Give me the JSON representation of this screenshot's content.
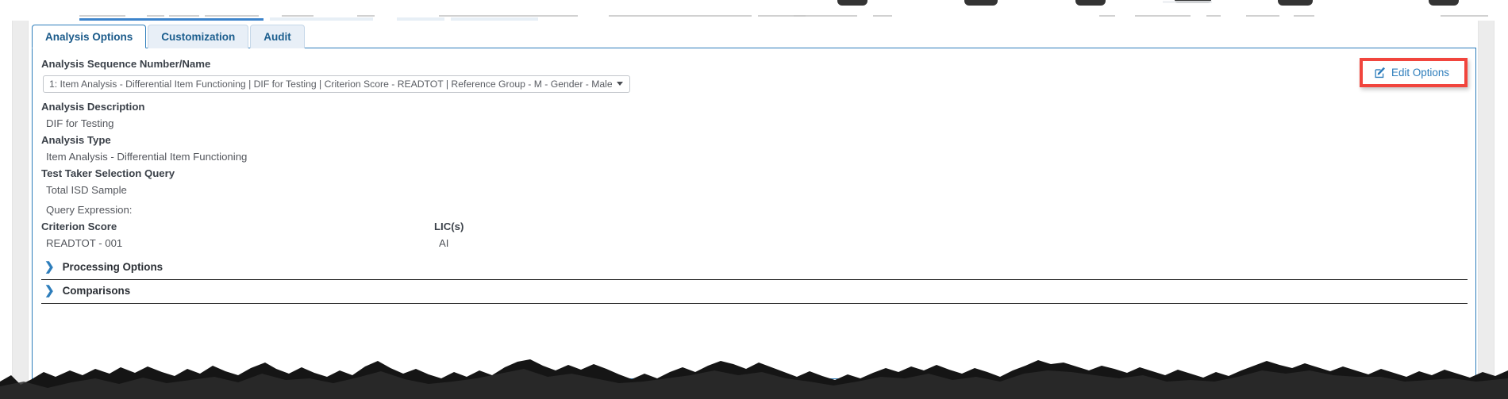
{
  "tabs": [
    {
      "label": "Analysis Options",
      "active": true
    },
    {
      "label": "Customization",
      "active": false
    },
    {
      "label": "Audit",
      "active": false
    }
  ],
  "form": {
    "sequence_label": "Analysis Sequence Number/Name",
    "sequence_value": "1: Item Analysis - Differential Item Functioning | DIF for Testing | Criterion Score - READTOT | Reference Group - M - Gender - Male",
    "description_label": "Analysis Description",
    "description_value": "DIF for Testing",
    "type_label": "Analysis Type",
    "type_value": "Item Analysis - Differential Item Functioning",
    "query_label": "Test Taker Selection Query",
    "query_value": "Total ISD Sample",
    "query_expression_label": "Query Expression:",
    "criterion_label": "Criterion Score",
    "criterion_value": "READTOT - 001",
    "lic_label": "LIC(s)",
    "lic_value": "AI"
  },
  "edit_options": {
    "label": "Edit Options",
    "icon": "edit-pencil-square-icon",
    "highlight_color": "#f1453d"
  },
  "sections": [
    {
      "label": "Processing Options",
      "icon": "chevron-right-icon",
      "expanded": false
    },
    {
      "label": "Comparisons",
      "icon": "chevron-right-icon",
      "expanded": false
    }
  ],
  "colors": {
    "accent": "#2d7dbb",
    "tab_active_text": "#1a5a8a",
    "label_text": "#3b4149",
    "value_text": "#53565c",
    "highlight": "#f1453d"
  }
}
